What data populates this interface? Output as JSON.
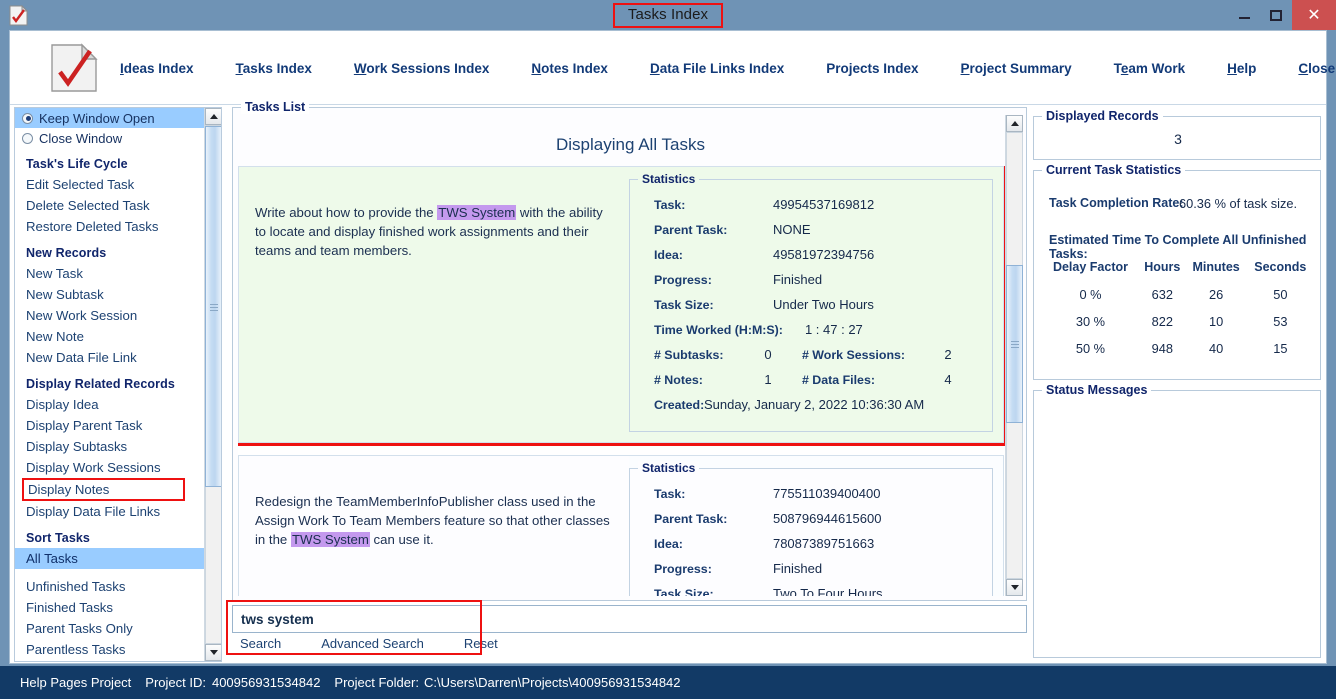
{
  "window": {
    "title": "Tasks Index",
    "app_icon": "checklist-document-icon",
    "controls": {
      "minimize": "minimize-icon",
      "maximize": "maximize-icon",
      "close": "close-icon"
    },
    "accent_red": "#ee1111",
    "titlebar_color": "#6f93b5",
    "statusbar_color": "#123a66",
    "highlight_purple": "#c499ee",
    "selection_blue": "#99ccff",
    "card_green": "#eefaea"
  },
  "nav": {
    "logo": "checklist-document-icon",
    "items": [
      {
        "label": "Ideas Index",
        "accel": "I"
      },
      {
        "label": "Tasks Index",
        "accel": "T"
      },
      {
        "label": "Work Sessions Index",
        "accel": "W"
      },
      {
        "label": "Notes Index",
        "accel": "N"
      },
      {
        "label": "Data File Links Index",
        "accel": "D"
      },
      {
        "label": "Projects Index",
        "accel": ""
      },
      {
        "label": "Project Summary",
        "accel": "P"
      },
      {
        "label": "Team Work",
        "accel": "e"
      },
      {
        "label": "Help",
        "accel": "H"
      },
      {
        "label": "Close Program",
        "accel": "C"
      }
    ]
  },
  "sidebar": {
    "radios": [
      {
        "label": "Keep Window Open",
        "selected": true
      },
      {
        "label": "Close Window",
        "selected": false
      }
    ],
    "groups": [
      {
        "heading": "Task's Life Cycle",
        "items": [
          {
            "label": "Edit Selected Task"
          },
          {
            "label": "Delete Selected Task"
          },
          {
            "label": "Restore Deleted Tasks"
          }
        ]
      },
      {
        "heading": "New Records",
        "items": [
          {
            "label": "New Task"
          },
          {
            "label": "New Subtask"
          },
          {
            "label": "New Work Session"
          },
          {
            "label": "New Note"
          },
          {
            "label": "New Data File Link"
          }
        ]
      },
      {
        "heading": "Display Related Records",
        "items": [
          {
            "label": "Display Idea"
          },
          {
            "label": "Display Parent Task"
          },
          {
            "label": "Display Subtasks"
          },
          {
            "label": "Display Work Sessions"
          },
          {
            "label": "Display Notes",
            "boxed": true
          },
          {
            "label": "Display Data File Links"
          }
        ]
      },
      {
        "heading": "Sort Tasks",
        "items": [
          {
            "label": "All Tasks",
            "selected": true
          },
          {
            "label": "Unfinished Tasks"
          },
          {
            "label": "Finished Tasks"
          },
          {
            "label": "Parent Tasks Only"
          },
          {
            "label": "Parentless Tasks"
          }
        ]
      }
    ]
  },
  "tasks_panel": {
    "legend": "Tasks List",
    "title": "Displaying All Tasks",
    "stat_legend": "Statistics",
    "labels": {
      "task": "Task:",
      "parent_task": "Parent Task:",
      "idea": "Idea:",
      "progress": "Progress:",
      "task_size": "Task Size:",
      "time_worked": "Time Worked (H:M:S):",
      "subtasks": "# Subtasks:",
      "work_sessions": "# Work Sessions:",
      "notes": "# Notes:",
      "data_files": "# Data Files:",
      "created": "Created:"
    },
    "cards": [
      {
        "highlighted": true,
        "desc_before": "Write about how to provide the ",
        "desc_match": "TWS System",
        "desc_after": " with the ability to locate and display finished work assignments and their teams and team members.",
        "task": "49954537169812",
        "parent_task": "NONE",
        "idea": "49581972394756",
        "progress": "Finished",
        "task_size": "Under Two Hours",
        "time_worked": "1  :  47  :  27",
        "subtasks": "0",
        "work_sessions": "2",
        "notes": "1",
        "data_files": "4",
        "created": "Sunday, January 2, 2022   10:36:30 AM"
      },
      {
        "highlighted": false,
        "desc_before": "Redesign the TeamMemberInfoPublisher class used in the Assign Work To Team Members feature so that other classes in the ",
        "desc_match": "TWS System",
        "desc_after": " can use it.",
        "task": "775511039400400",
        "parent_task": "508796944615600",
        "idea": "78087389751663",
        "progress": "Finished",
        "task_size": "Two To Four Hours"
      }
    ]
  },
  "search": {
    "value": "tws system",
    "placeholder": "",
    "links": [
      "Search",
      "Advanced Search",
      "Reset"
    ]
  },
  "right_panel": {
    "displayed_records": {
      "legend": "Displayed Records",
      "count": "3"
    },
    "current_task_statistics": {
      "legend": "Current Task Statistics",
      "completion_rate_label": "Task Completion Rate:",
      "completion_rate_value": "60.36 % of task size.",
      "estimate_label": "Estimated Time To Complete All Unfinished Tasks:",
      "columns": [
        "Delay Factor",
        "Hours",
        "Minutes",
        "Seconds"
      ],
      "rows": [
        [
          "0 %",
          "632",
          "26",
          "50"
        ],
        [
          "30 %",
          "822",
          "10",
          "53"
        ],
        [
          "50 %",
          "948",
          "40",
          "15"
        ]
      ]
    },
    "status_messages": {
      "legend": "Status Messages",
      "body": ""
    }
  },
  "statusbar": {
    "project_name": "Help Pages Project",
    "project_id_label": "Project ID:",
    "project_id": "400956931534842",
    "project_folder_label": "Project Folder:",
    "project_folder": "C:\\Users\\Darren\\Projects\\400956931534842"
  }
}
